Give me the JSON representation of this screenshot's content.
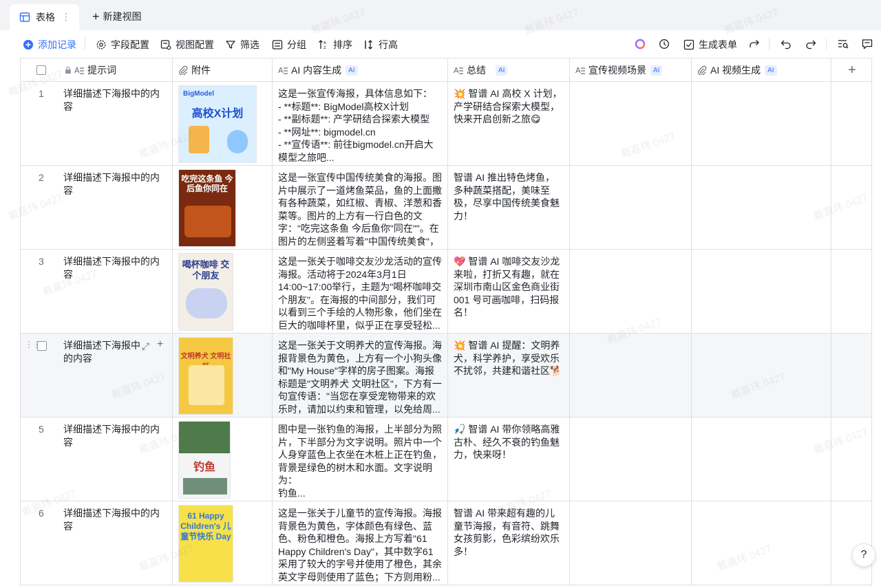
{
  "tabs": {
    "active": "表格",
    "more": "⋮",
    "new_view": "新建视图"
  },
  "toolbar": {
    "add_record": "添加记录",
    "field_config": "字段配置",
    "view_config": "视图配置",
    "filter": "筛选",
    "group": "分组",
    "sort": "排序",
    "row_height": "行高",
    "generate_form": "生成表单"
  },
  "columns": {
    "prompt": "提示词",
    "attachment": "附件",
    "ai_content": "AI 内容生成",
    "summary": "总结",
    "video_scene": "宣传视频场景",
    "ai_video": "AI 视频生成",
    "ai_badge": "AI"
  },
  "rows": [
    {
      "num": "1",
      "prompt": "详细描述下海报中的内容",
      "thumb_title": "高校X计划",
      "thumb_brand": "BigModel",
      "content": "这是一张宣传海报，具体信息如下：\n- **标题**: BigModel高校X计划\n- **副标题**: 产学研结合探索大模型\n- **网址**: bigmodel.cn\n- **宣传语**: 前往bigmodel.cn开启大模型之旅吧...",
      "summary": "💥 智谱 AI 高校 X 计划，产学研结合探索大模型，快来开启创新之旅😋"
    },
    {
      "num": "2",
      "prompt": "详细描述下海报中的内容",
      "thumb_title": "吃完这条鱼 今后鱼你同在",
      "content": "这是一张宣传中国传统美食的海报。图片中展示了一道烤鱼菜品，鱼的上面撒有各种蔬菜，如红椒、青椒、洋葱和香菜等。图片的上方有一行白色的文字：\"吃完这条鱼 今后鱼你\"同在\"\"。在图片的左侧竖着写着\"中国传统美食\"，右...",
      "summary": "智谱 AI 推出特色烤鱼，多种蔬菜搭配，美味至极，尽享中国传统美食魅力！"
    },
    {
      "num": "3",
      "prompt": "详细描述下海报中的内容",
      "thumb_title": "喝杯咖啡 交个朋友",
      "content": "这是一张关于咖啡交友沙龙活动的宣传海报。活动将于2024年3月1日14:00~17:00举行，主题为\"喝杯咖啡交个朋友\"。在海报的中间部分，我们可以看到三个手绘的人物形象，他们坐在巨大的咖啡杯里，似乎正在享受轻松...",
      "summary": "💖 智谱 AI 咖啡交友沙龙来啦，打折又有趣，就在深圳市南山区金色商业街 001 号可画咖啡，扫码报名！"
    },
    {
      "num": "",
      "prompt": "详细描述下海报中的内容",
      "thumb_title": "文明养犬 文明社区",
      "content": "这是一张关于文明养犬的宣传海报。海报背景色为黄色，上方有一个小狗头像和\"My House\"字样的房子图案。海报标题是\"文明养犬 文明社区\"，下方有一句宣传语：\"当您在享受宠物带来的欢乐时，请加以约束和管理，以免给周...",
      "summary": "💥 智谱 AI 提醒：文明养犬，科学养护，享受欢乐不扰邻，共建和谐社区🐕"
    },
    {
      "num": "5",
      "prompt": "详细描述下海报中的内容",
      "thumb_title": "钓鱼",
      "content": "图中是一张钓鱼的海报，上半部分为照片，下半部分为文字说明。照片中一个人身穿蓝色上衣坐在木桩上正在钓鱼，背景是绿色的树木和水面。文字说明为：\n钓鱼...",
      "summary": "🎣 智谱 AI 带你领略高雅古朴、经久不衰的钓鱼魅力，快来呀！"
    },
    {
      "num": "6",
      "prompt": "详细描述下海报中的内容",
      "thumb_title": "61 Happy Children's 儿童节快乐 Day",
      "content": "这是一张关于儿童节的宣传海报。海报背景色为黄色，字体颜色有绿色、蓝色、粉色和橙色。海报上方写着\"61 Happy Children's Day\"，其中数字61采用了较大的字号并使用了橙色，其余英文字母则使用了蓝色；下方则用粉...",
      "summary": "智谱 AI 带来超有趣的儿童节海报，有音符、跳舞女孩剪影，色彩缤纷欢乐多！"
    }
  ],
  "watermark": "戴嘉玮 0427",
  "help": "?"
}
